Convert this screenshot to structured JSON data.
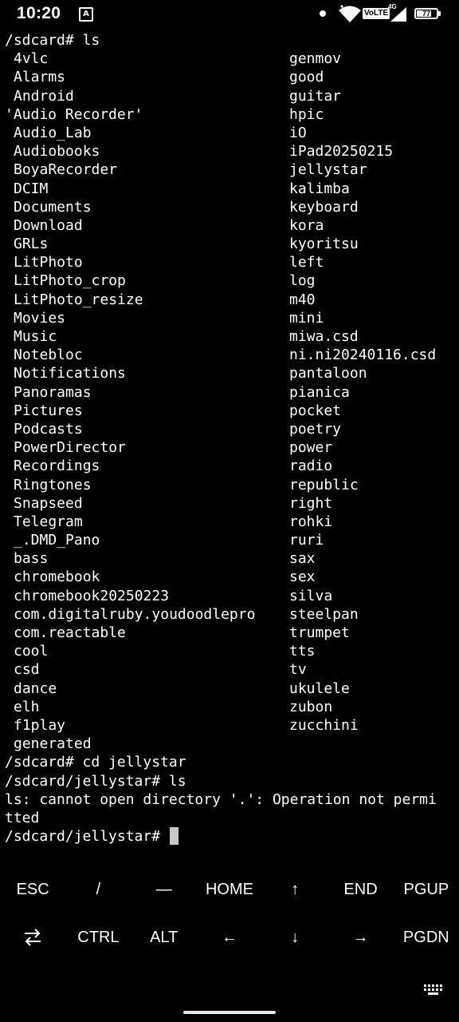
{
  "status_bar": {
    "time": "10:20",
    "termux_icon": "A",
    "volte": "VoLTE",
    "network": "4G",
    "battery": "77",
    "battery_level": 0.77,
    "icons": [
      "termux-notification-icon",
      "dot-icon",
      "wifi-icon",
      "volte-icon",
      "signal-icon",
      "battery-icon"
    ]
  },
  "terminal": {
    "prompt1": "/sdcard# ls",
    "listing": [
      [
        "4vlc",
        "genmov"
      ],
      [
        "Alarms",
        "good"
      ],
      [
        "Android",
        "guitar"
      ],
      [
        "'Audio Recorder'",
        "hpic"
      ],
      [
        "Audio_Lab",
        "iO"
      ],
      [
        "Audiobooks",
        "iPad20250215"
      ],
      [
        "BoyaRecorder",
        "jellystar"
      ],
      [
        "DCIM",
        "kalimba"
      ],
      [
        "Documents",
        "keyboard"
      ],
      [
        "Download",
        "kora"
      ],
      [
        "GRLs",
        "kyoritsu"
      ],
      [
        "LitPhoto",
        "left"
      ],
      [
        "LitPhoto_crop",
        "log"
      ],
      [
        "LitPhoto_resize",
        "m40"
      ],
      [
        "Movies",
        "mini"
      ],
      [
        "Music",
        "miwa.csd"
      ],
      [
        "Notebloc",
        "ni.ni20240116.csd"
      ],
      [
        "Notifications",
        "pantaloon"
      ],
      [
        "Panoramas",
        "pianica"
      ],
      [
        "Pictures",
        "pocket"
      ],
      [
        "Podcasts",
        "poetry"
      ],
      [
        "PowerDirector",
        "power"
      ],
      [
        "Recordings",
        "radio"
      ],
      [
        "Ringtones",
        "republic"
      ],
      [
        "Snapseed",
        "right"
      ],
      [
        "Telegram",
        "rohki"
      ],
      [
        "_.DMD_Pano",
        "ruri"
      ],
      [
        "bass",
        "sax"
      ],
      [
        "chromebook",
        "sex"
      ],
      [
        "chromebook20250223",
        "silva"
      ],
      [
        "com.digitalruby.youdoodlepro",
        "steelpan"
      ],
      [
        "com.reactable",
        "trumpet"
      ],
      [
        "cool",
        "tts"
      ],
      [
        "csd",
        "tv"
      ],
      [
        "dance",
        "ukulele"
      ],
      [
        "elh",
        "zubon"
      ],
      [
        "f1play",
        "zucchini"
      ],
      [
        "generated",
        ""
      ]
    ],
    "after": [
      "/sdcard# cd jellystar",
      "/sdcard/jellystar# ls",
      "ls: cannot open directory '.': Operation not permi",
      "tted"
    ],
    "current_prompt": "/sdcard/jellystar# "
  },
  "extra_keys": {
    "row1": [
      {
        "label": "ESC",
        "name": "esc-key"
      },
      {
        "label": "/",
        "name": "slash-key"
      },
      {
        "label": "—",
        "name": "dash-key"
      },
      {
        "label": "HOME",
        "name": "home-key"
      },
      {
        "label": "↑",
        "name": "up-arrow-key"
      },
      {
        "label": "END",
        "name": "end-key"
      },
      {
        "label": "PGUP",
        "name": "pgup-key"
      }
    ],
    "row2": [
      {
        "label": "",
        "name": "tab-key",
        "icon": "tab-arrows-icon"
      },
      {
        "label": "CTRL",
        "name": "ctrl-key"
      },
      {
        "label": "ALT",
        "name": "alt-key"
      },
      {
        "label": "←",
        "name": "left-arrow-key"
      },
      {
        "label": "↓",
        "name": "down-arrow-key"
      },
      {
        "label": "→",
        "name": "right-arrow-key"
      },
      {
        "label": "PGDN",
        "name": "pgdn-key"
      }
    ]
  },
  "bottom": {
    "keyboard_icon": "keyboard-icon",
    "nav_handle": "gesture-handle"
  }
}
